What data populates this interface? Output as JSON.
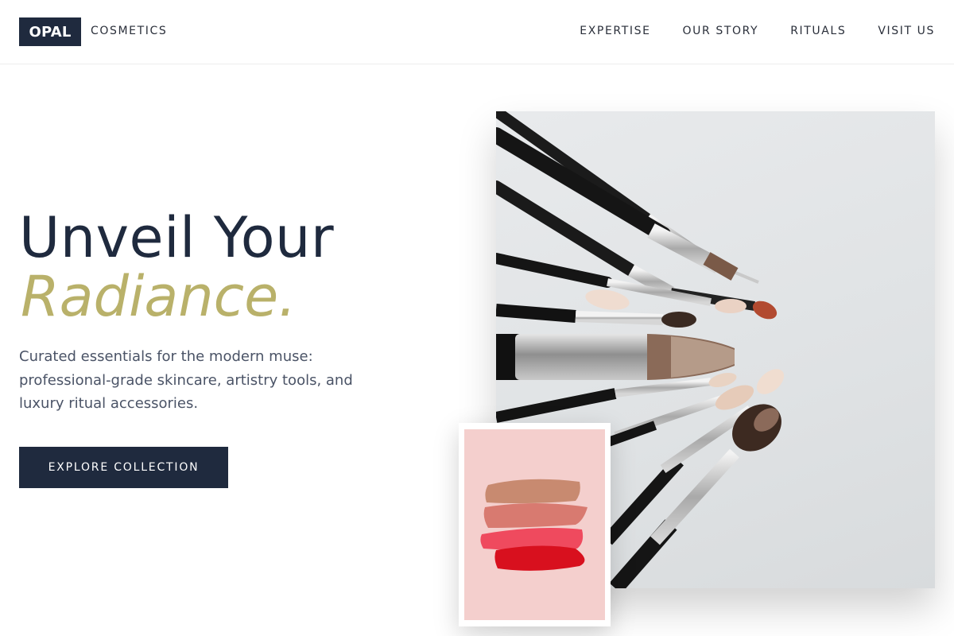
{
  "brand": {
    "logo_text": "OPAL",
    "name": "COSMETICS"
  },
  "nav": {
    "items": [
      {
        "label": "EXPERTISE"
      },
      {
        "label": "OUR STORY"
      },
      {
        "label": "RITUALS"
      },
      {
        "label": "VISIT US"
      }
    ]
  },
  "hero": {
    "headline": "Unveil Your",
    "headline_accent": "Radiance.",
    "description": "Curated essentials for the modern muse: professional-grade skincare, artistry tools, and luxury ritual accessories.",
    "cta_label": "EXPLORE COLLECTION"
  },
  "images": {
    "main": "makeup-brushes-photo",
    "inset": "lipstick-swatches-photo"
  },
  "colors": {
    "navy": "#1f2a3e",
    "accent_gold": "#b9b16a",
    "swatch_background": "#f4cfcd"
  }
}
